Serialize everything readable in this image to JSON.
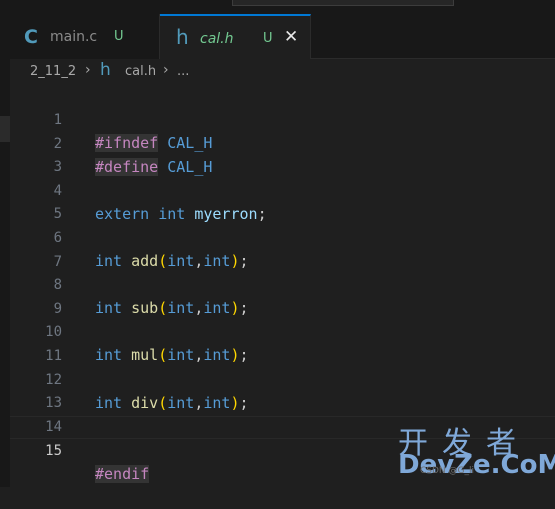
{
  "tabs": [
    {
      "name": "main.c",
      "icon": "c-file-icon",
      "icon_glyph": "C",
      "status": "U",
      "active": false
    },
    {
      "name": "cal.h",
      "icon": "h-file-icon",
      "icon_glyph": "h",
      "status": "U",
      "active": true,
      "close_glyph": "✕"
    }
  ],
  "breadcrumb": {
    "folder": "2_11_2",
    "sep": "›",
    "file_icon_glyph": "h",
    "file": "cal.h",
    "more": "..."
  },
  "editor": {
    "current_line": 15,
    "lines": [
      {
        "n": "1"
      },
      {
        "n": "2"
      },
      {
        "n": "3"
      },
      {
        "n": "4"
      },
      {
        "n": "5"
      },
      {
        "n": "6"
      },
      {
        "n": "7"
      },
      {
        "n": "8"
      },
      {
        "n": "9"
      },
      {
        "n": "10"
      },
      {
        "n": "11"
      },
      {
        "n": "12"
      },
      {
        "n": "13"
      },
      {
        "n": "14"
      },
      {
        "n": "15"
      }
    ],
    "tokens": {
      "ifndef": "#ifndef",
      "define": "#define",
      "macro": "CAL_H",
      "extern": "extern",
      "int": "int",
      "var": "myerron",
      "add": "add",
      "sub": "sub",
      "mul": "mul",
      "div": "div",
      "semi": ";",
      "lpar": "(",
      "rpar": ")",
      "comma": ",",
      "endif": "#endif"
    }
  },
  "colors": {
    "accent": "#0078d4",
    "keyword": "#569cd6",
    "preproc": "#c586c0",
    "function": "#dcdcaa",
    "variable": "#9cdcfe",
    "untracked": "#73c991"
  },
  "watermark": {
    "line1": "开发者",
    "line2": "DevZe.CoM",
    "line3": "CSDN @G_li"
  }
}
